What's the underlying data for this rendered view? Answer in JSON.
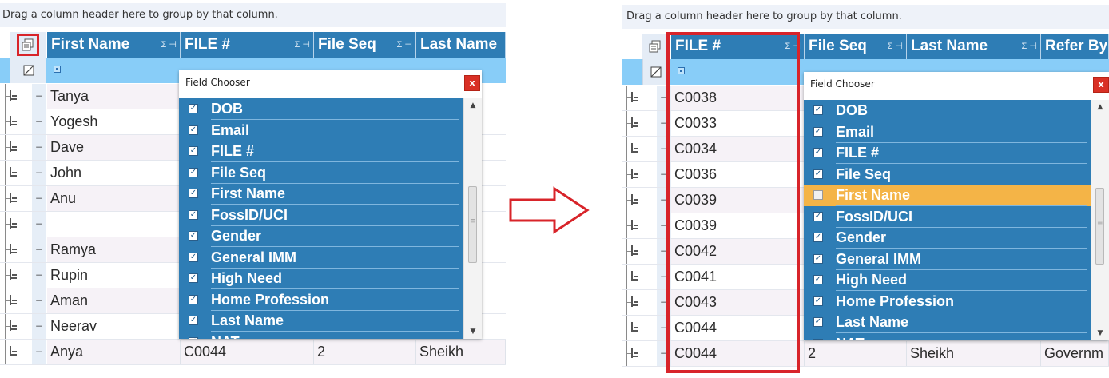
{
  "group_bar_text": "Drag a column header here to group by that column.",
  "left": {
    "headers": [
      "First Name",
      "FILE #",
      "File Seq",
      "Last Name"
    ],
    "rows": [
      "Tanya",
      "Yogesh",
      "Dave",
      "John",
      "Anu",
      "",
      "Ramya",
      "Rupin",
      "Aman",
      "Neerav"
    ],
    "last_row": {
      "first_name": "Anya",
      "file": "C0044",
      "file_seq": "2",
      "last_name": "Sheikh"
    }
  },
  "right": {
    "headers": [
      "FILE #",
      "File Seq",
      "Last Name",
      "Refer By"
    ],
    "file_values": [
      "C0038",
      "C0033",
      "C0034",
      "C0036",
      "C0039",
      "C0039",
      "C0042",
      "C0041",
      "C0043",
      "C0044"
    ],
    "last_row": {
      "file": "C0044",
      "file_seq": "2",
      "last_name": "Sheikh",
      "refer_by": "Governm"
    }
  },
  "field_chooser": {
    "title": "Field Chooser",
    "close": "x",
    "items": [
      "DOB",
      "Email",
      "FILE #",
      "File Seq",
      "First Name",
      "FossID/UCI",
      "Gender",
      "General IMM",
      "High Need",
      "Home Profession",
      "Last Name",
      "NAT"
    ],
    "left_checked": [
      true,
      true,
      true,
      true,
      true,
      true,
      true,
      true,
      true,
      true,
      true,
      true
    ],
    "right_checked": [
      true,
      true,
      true,
      true,
      false,
      true,
      true,
      true,
      true,
      true,
      true,
      true
    ],
    "right_highlighted_index": 4
  },
  "glyphs": {
    "sum_pin": "Σ ⊣",
    "pin": "⊣",
    "check": "✓"
  },
  "colors": {
    "header_blue": "#2e7db5",
    "filter_blue": "#88cdf8",
    "highlight_orange": "#f4b447",
    "annotation_red": "#d8242a"
  }
}
